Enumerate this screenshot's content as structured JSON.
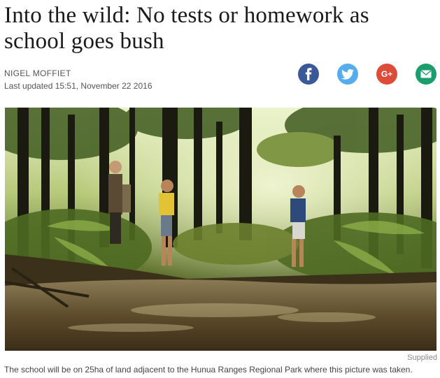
{
  "article": {
    "headline": "Into the wild: No tests or homework as school goes bush",
    "author": "NIGEL MOFFIET",
    "updated": "Last updated 15:51, November 22 2016"
  },
  "share": {
    "facebook_icon": "facebook-icon",
    "twitter_icon": "twitter-icon",
    "googleplus_label": "G+",
    "email_icon": "email-icon",
    "colors": {
      "facebook": "#3b5998",
      "twitter": "#55acee",
      "googleplus": "#dd4b39",
      "email": "#1b9e6d"
    }
  },
  "photo": {
    "credit": "Supplied",
    "caption": "The school will be on 25ha of land adjacent to the Hunua Ranges Regional Park where this picture was taken."
  }
}
